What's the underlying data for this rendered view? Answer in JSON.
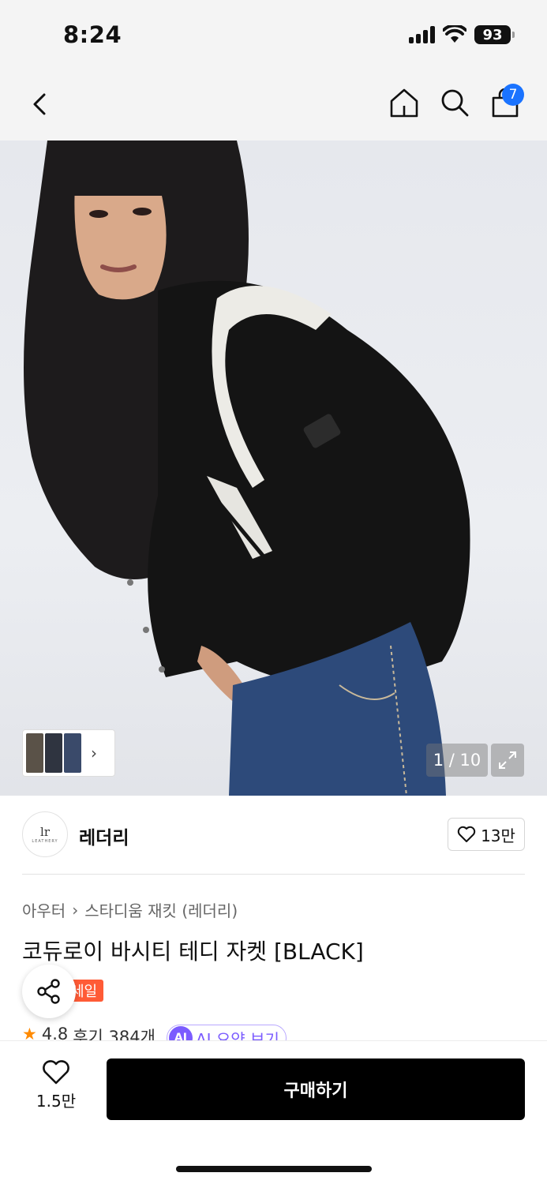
{
  "status_bar": {
    "time": "8:24",
    "battery": "93"
  },
  "nav": {
    "cart_count": "7"
  },
  "gallery": {
    "counter": "1 / 10",
    "thumb_colors": [
      "#5a5248",
      "#2f3440",
      "#3a4a6a"
    ]
  },
  "brand": {
    "name": "레더리",
    "logo_mark": "lr",
    "logo_word": "LEATHERY",
    "likes": "13만"
  },
  "product": {
    "breadcrumb": [
      "아우터",
      "스타디움 재킷 (레더리)"
    ],
    "title": "코듀로이 바시티 테디 자켓 [BLACK]",
    "badge": "세일",
    "rating": "4.8",
    "reviews": "후기 384개",
    "ai_icon": "AI",
    "ai_summary": "AI 요약 보기"
  },
  "bottom": {
    "wish_count": "1.5만",
    "buy_label": "구매하기"
  },
  "colors": {
    "accent_blue": "#1a73ff",
    "sale_orange": "#ff5b36",
    "star": "#ff8a00",
    "ai_purple": "#7b5cff"
  },
  "icons": [
    "back-icon",
    "home-icon",
    "search-icon",
    "shopping-bag-icon",
    "expand-icon",
    "share-icon",
    "heart-icon",
    "star-icon"
  ]
}
